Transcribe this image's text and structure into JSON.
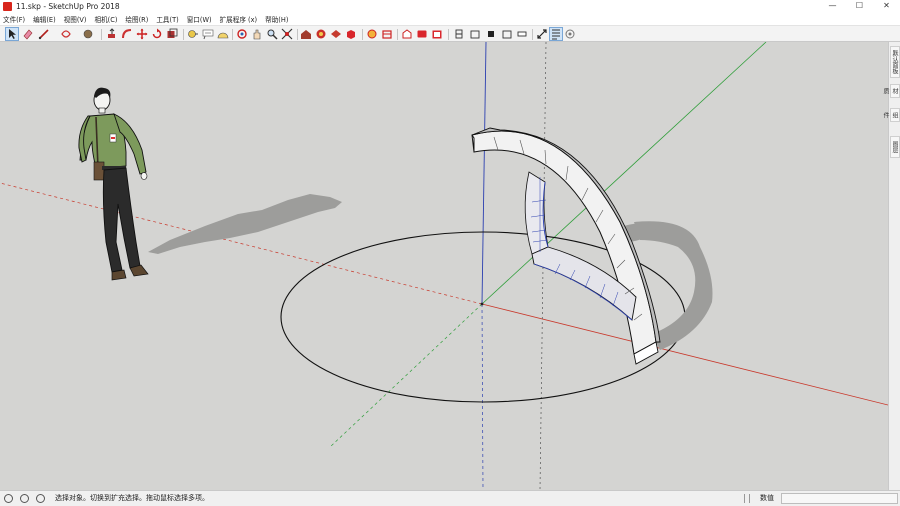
{
  "window": {
    "title": "11.skp - SketchUp Pro 2018",
    "controls": {
      "minimize": "—",
      "maximize": "☐",
      "close": "✕"
    }
  },
  "menu": [
    "文件(F)",
    "编辑(E)",
    "视图(V)",
    "相机(C)",
    "绘图(R)",
    "工具(T)",
    "窗口(W)",
    "扩展程序 (x)",
    "帮助(H)"
  ],
  "toolbar": {
    "icons": [
      "select-icon",
      "eraser-icon",
      "line-icon",
      "shape-icon",
      "paint-bucket-icon",
      "push-pull-icon",
      "follow-me-icon",
      "move-icon",
      "rotate-icon",
      "offset-icon",
      "tape-measure-icon",
      "text-icon",
      "protractor-icon",
      "orbit-icon",
      "pan-icon",
      "zoom-icon",
      "zoom-extents-icon",
      "warehouse-icon",
      "components-icon",
      "extension-warehouse-icon",
      "styles-icon",
      "layers-icon",
      "section-plane-icon",
      "section-display-icon",
      "section-cut-icon",
      "iso-view-icon",
      "top-view-icon",
      "front-view-icon",
      "right-view-icon",
      "back-view-icon",
      "left-view-icon",
      "xray-icon",
      "outliner-icon",
      "fog-icon"
    ]
  },
  "tray": {
    "tabs": [
      "默认面板",
      "材质",
      "组件",
      "图层"
    ]
  },
  "status": {
    "text": "选择对象。切换到扩充选择。拖动鼠标选择多项。",
    "measure_label": "数值",
    "measure_value": ""
  },
  "scene": {
    "background": "#d4d4d2",
    "axis_colors": {
      "red": "#c8392c",
      "green": "#2f9e3a",
      "blue": "#2b3fb0"
    }
  }
}
